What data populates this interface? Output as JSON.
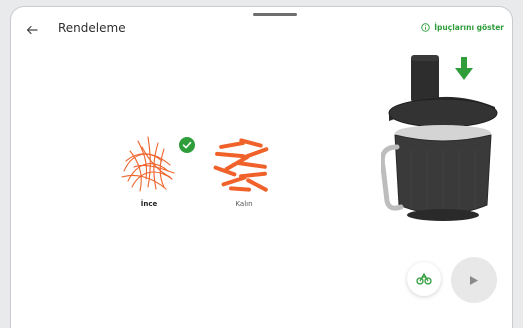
{
  "header": {
    "title": "Rendeleme",
    "tips_label": "İpuçlarını göster"
  },
  "options": [
    {
      "label": "İnce",
      "selected": true,
      "icon": "thin-grated-carrot-icon"
    },
    {
      "label": "Kalın",
      "selected": false,
      "icon": "thick-grated-carrot-icon"
    }
  ],
  "icons": {
    "back": "back-arrow-icon",
    "tips": "info-circle-icon",
    "check": "check-icon",
    "blade": "blade-attachment-icon",
    "play": "play-icon",
    "insert": "arrow-down-icon"
  },
  "colors": {
    "accent_green": "#2e9d3a",
    "carrot_orange": "#f0622a",
    "background": "#ffffff",
    "play_button_bg": "#e8e8e8"
  }
}
